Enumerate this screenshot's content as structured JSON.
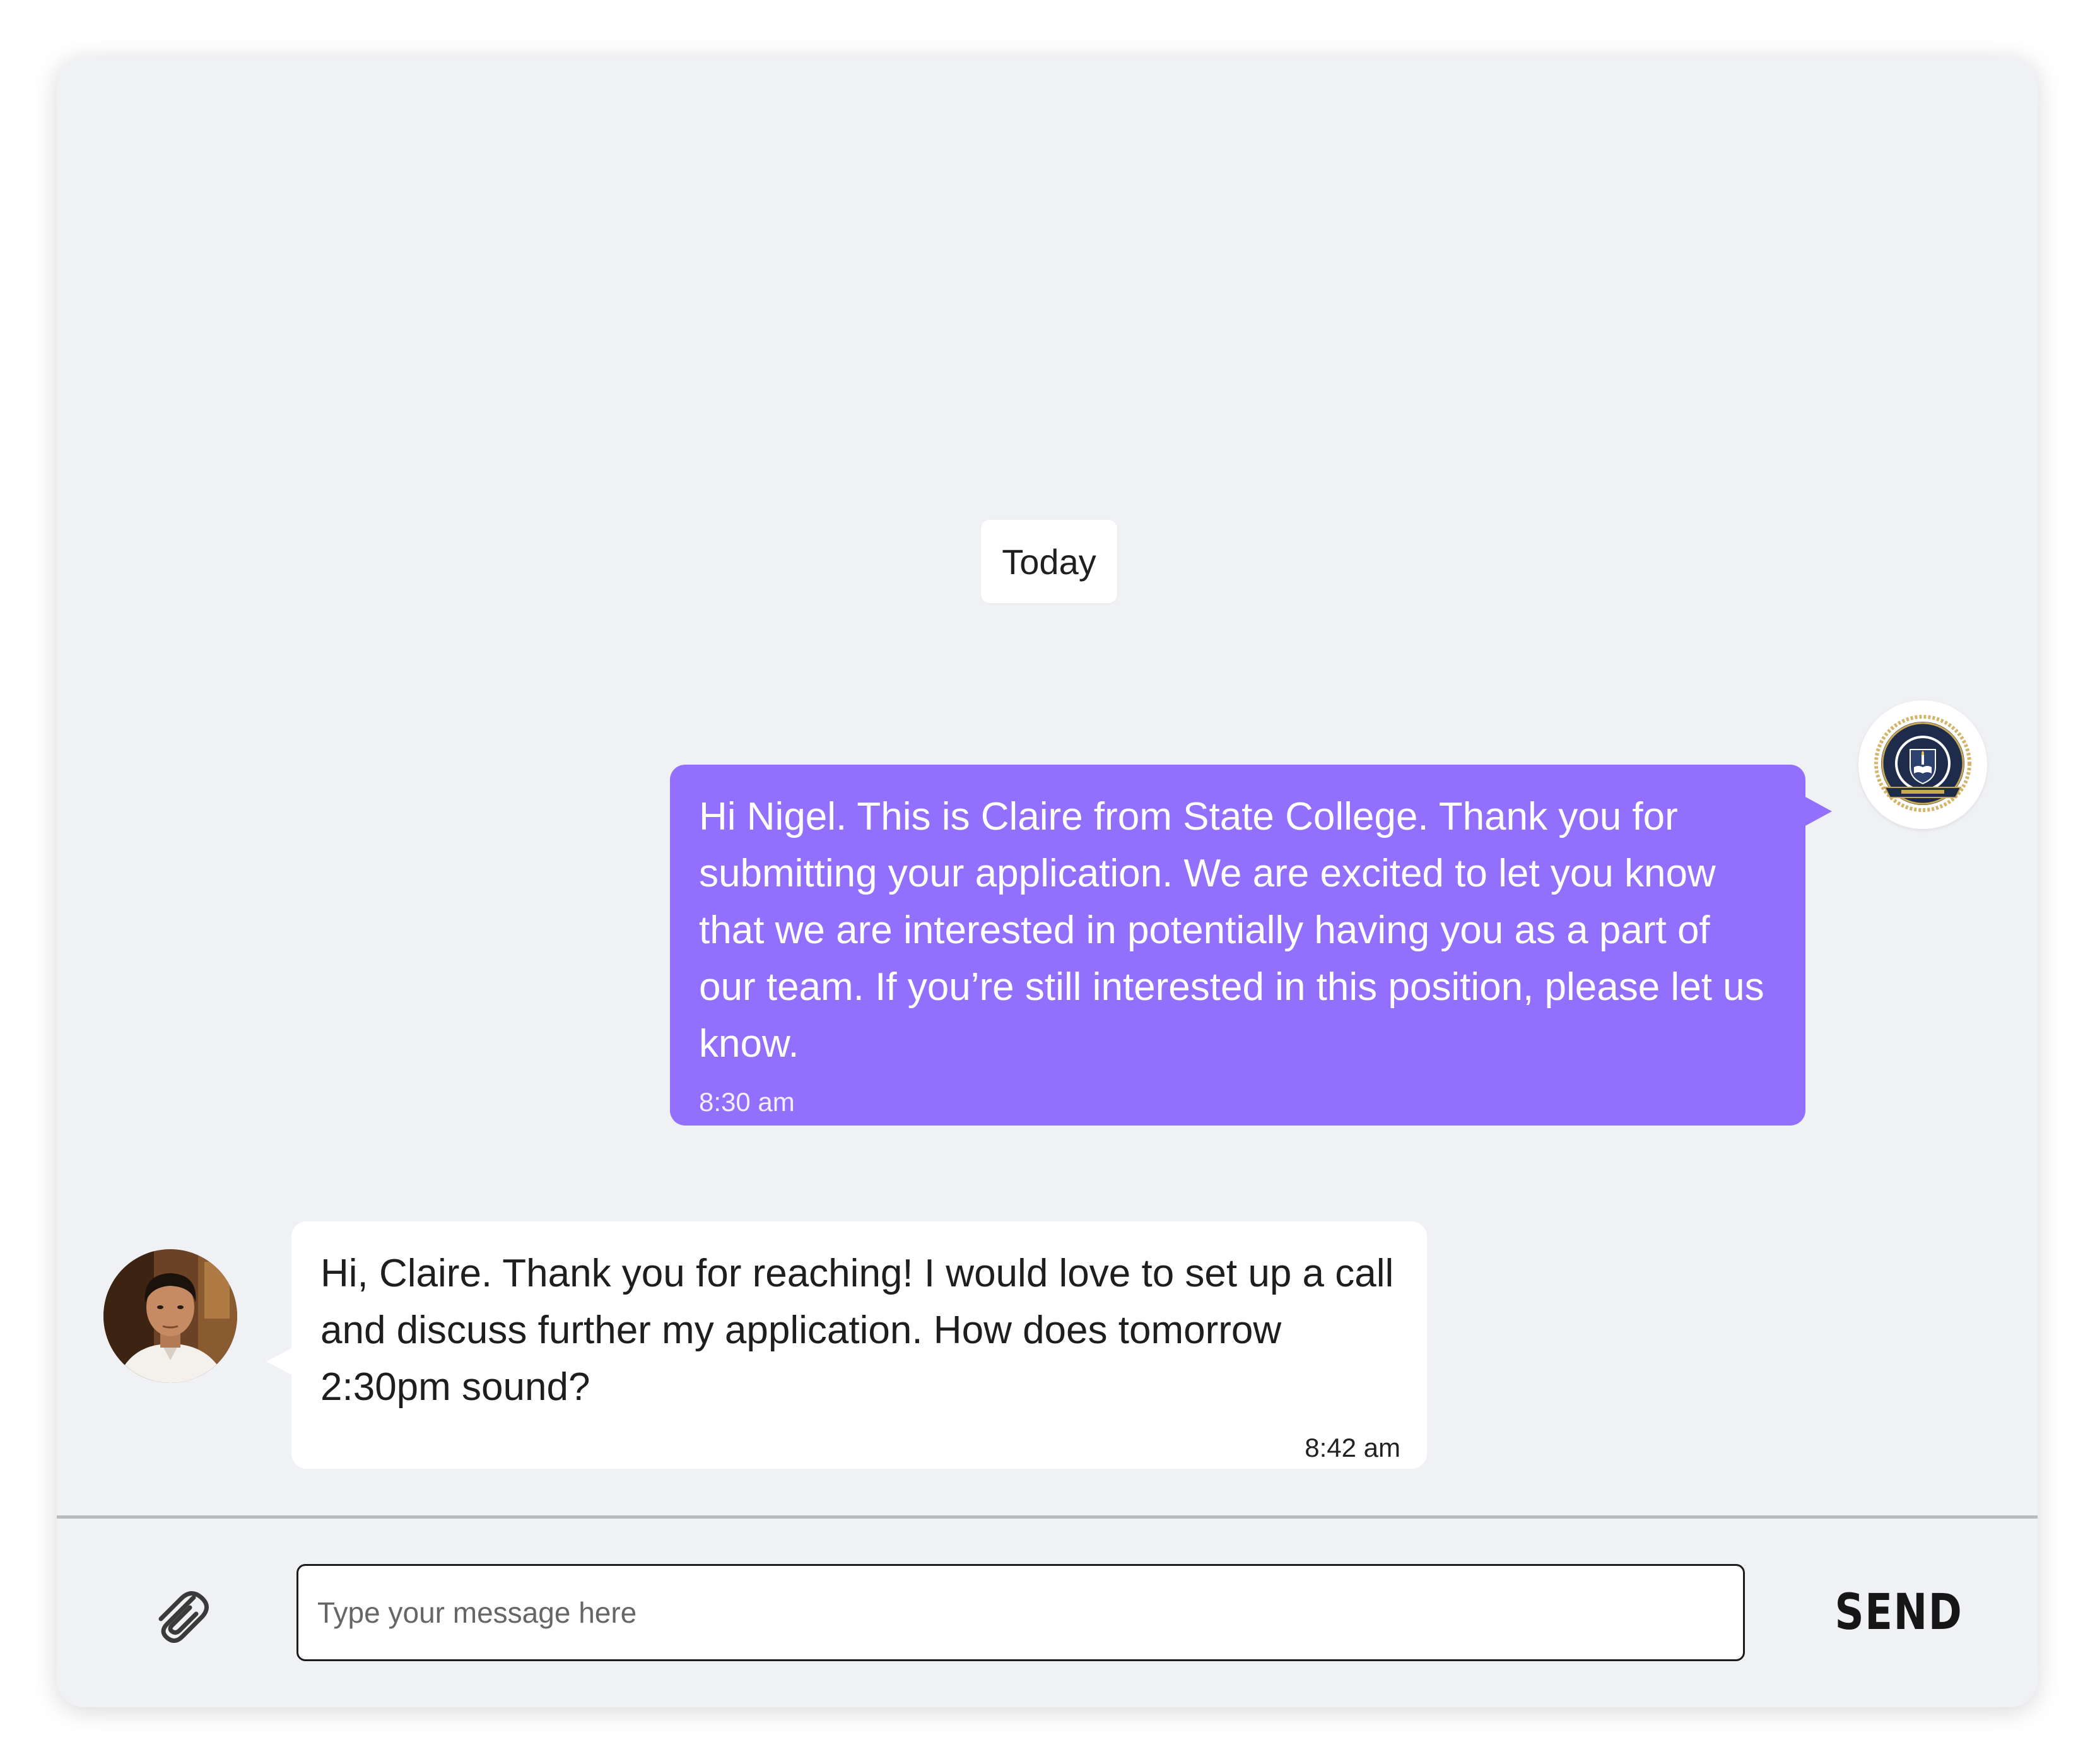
{
  "chat": {
    "day_label": "Today",
    "messages": [
      {
        "direction": "outgoing",
        "sender": "State College",
        "text": "Hi Nigel. This is Claire from State College. Thank you for submitting your application. We are excited to let you know that we are interested in potentially having you as a part of our team. If you’re still interested in this position, please let us know.",
        "time": "8:30 am",
        "bubble_color": "#9270fd"
      },
      {
        "direction": "incoming",
        "sender": "Nigel",
        "text": "Hi, Claire. Thank you for reaching! I would love to set up a call and discuss further my application. How does tomorrow 2:30pm sound?",
        "time": "8:42 am",
        "bubble_color": "#ffffff"
      }
    ]
  },
  "composer": {
    "placeholder": "Type your message here",
    "value": "",
    "attach_icon": "paperclip-icon",
    "send_label": "SEND"
  },
  "colors": {
    "background": "#f0f1f4",
    "accent": "#9270fd"
  }
}
